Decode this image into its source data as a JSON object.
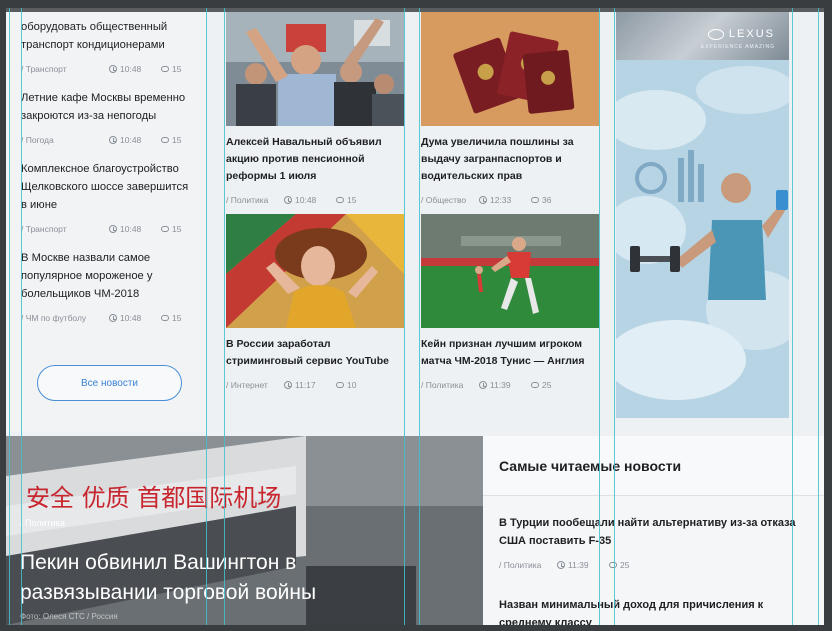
{
  "left_news": [
    {
      "title": "оборудовать общественный транспорт кондиционерами",
      "category": "/ Транспорт",
      "time": "10:48",
      "comments": "15"
    },
    {
      "title": "Летние кафе Москвы временно закроются из-за непогоды",
      "category": "/ Погода",
      "time": "10:48",
      "comments": "15"
    },
    {
      "title": "Комплексное благоустройство Щелковского шоссе завершится в июне",
      "category": "/ Транспорт",
      "time": "10:48",
      "comments": "15"
    },
    {
      "title": "В Москве назвали самое популярное мороженое у болельщиков ЧМ-2018",
      "category": "/ ЧМ по футболу",
      "time": "10:48",
      "comments": "15"
    }
  ],
  "all_news_label": "Все новости",
  "cards": [
    {
      "title": "Алексей Навальный объявил акцию против пенсионной реформы 1 июля",
      "category": "/ Политика",
      "time": "10:48",
      "comments": "15"
    },
    {
      "title": "Дума увеличила пошлины за выдачу загранпаспортов и водительских прав",
      "category": "/ Общество",
      "time": "12:33",
      "comments": "36"
    },
    {
      "title": "В России заработал стриминговый сервис YouTube",
      "category": "/ Интернет",
      "time": "11:17",
      "comments": "10"
    },
    {
      "title": "Кейн признан лучшим игроком матча ЧМ-2018 Тунис — Англия",
      "category": "/ Политика",
      "time": "11:39",
      "comments": "25"
    }
  ],
  "ad": {
    "brand": "LEXUS",
    "tagline": "EXPERIENCE AMAZING"
  },
  "hero": {
    "category": "/ Политика",
    "title": "Пекин обвинил Вашингтон в развязывании торговой войны",
    "sign_text": "安全 优质 首都国际机场",
    "footer": "Фото: Олеся СТС / Россия"
  },
  "most_read": {
    "heading": "Самые читаемые новости",
    "items": [
      {
        "title": "В Турции пообещали найти альтернативу из-за отказа США поставить F-35",
        "category": "/ Политика",
        "time": "11:39",
        "comments": "25"
      },
      {
        "title": "Назван минимальный доход для причисления к среднему классу",
        "category": "",
        "time": "",
        "comments": ""
      }
    ]
  }
}
